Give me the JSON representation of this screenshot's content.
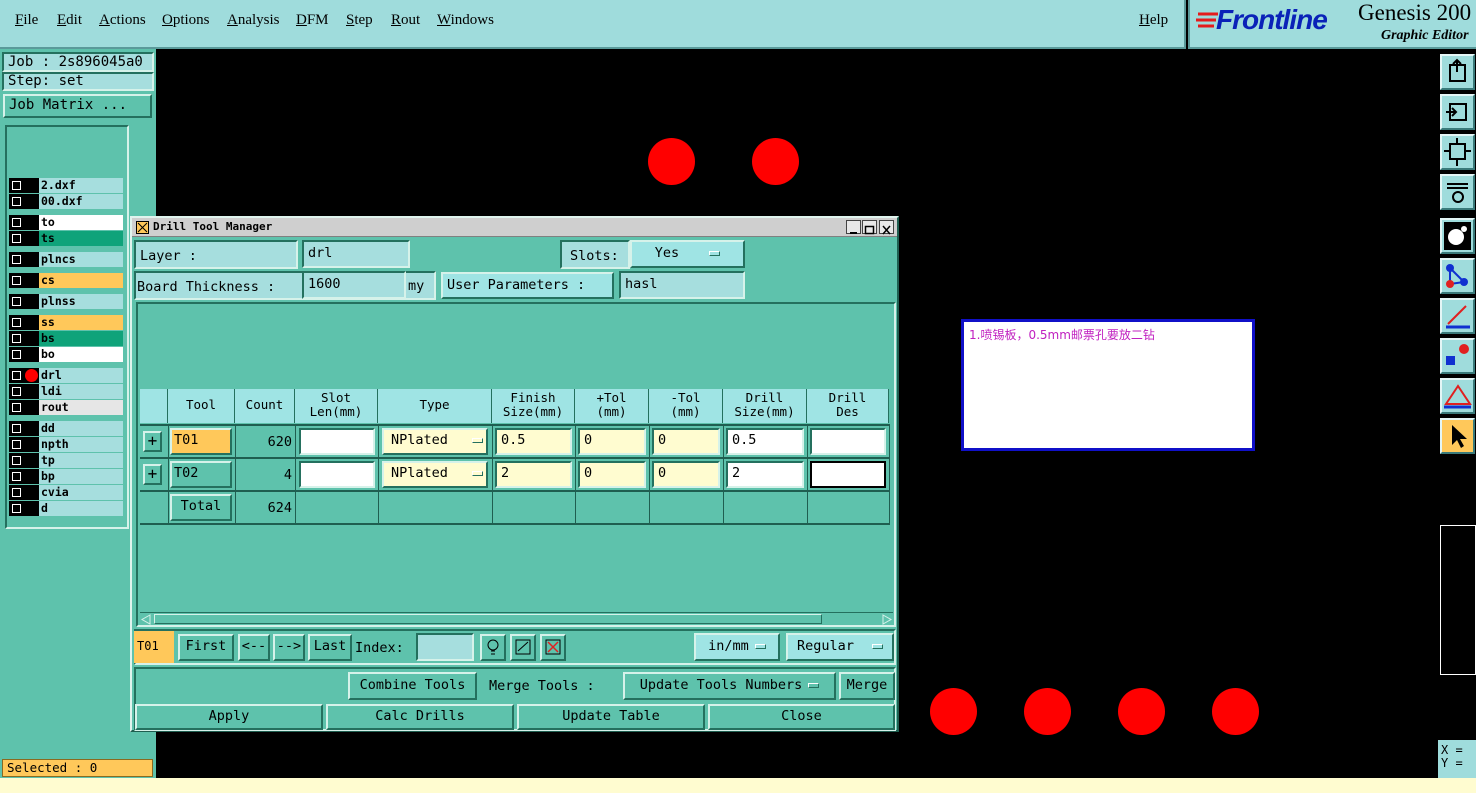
{
  "menu": [
    "File",
    "Edit",
    "Actions",
    "Options",
    "Analysis",
    "DFM",
    "Step",
    "Rout",
    "Windows"
  ],
  "help": "Help",
  "brand": {
    "logo": "Frontline",
    "product": "Genesis 200",
    "subtitle": "Graphic Editor",
    "logo_color": "#0a22b8",
    "product_color": "#000000"
  },
  "left": {
    "job": "Job : 2s896045a0",
    "step": "Step: set",
    "job_matrix": "Job Matrix ...",
    "selected": "Selected : 0",
    "layers": [
      {
        "name": "2.dxf",
        "color": "#a6dede"
      },
      {
        "name": "00.dxf",
        "color": "#a6dede"
      },
      {
        "name": "to",
        "color": "#ffffff"
      },
      {
        "name": "ts",
        "color": "#0fa37a"
      },
      {
        "name": "plncs",
        "color": "#a6dede"
      },
      {
        "name": "cs",
        "color": "#ffc85a"
      },
      {
        "name": "plnss",
        "color": "#a6dede"
      },
      {
        "name": "ss",
        "color": "#ffc85a"
      },
      {
        "name": "bs",
        "color": "#0fa37a"
      },
      {
        "name": "bo",
        "color": "#ffffff"
      },
      {
        "name": "drl",
        "color": "#a6dede"
      },
      {
        "name": "ldi",
        "color": "#a6dede"
      },
      {
        "name": "rout",
        "color": "#e6e6e6"
      },
      {
        "name": "dd",
        "color": "#a6dede"
      },
      {
        "name": "npth",
        "color": "#a6dede"
      },
      {
        "name": "tp",
        "color": "#a6dede"
      },
      {
        "name": "bp",
        "color": "#a6dede"
      },
      {
        "name": "cvia",
        "color": "#a6dede"
      },
      {
        "name": "d",
        "color": "#a6dede"
      }
    ]
  },
  "note": "1.喷锡板，0.5mm邮票孔要放二钻",
  "dialog": {
    "title": "Drill Tool Manager",
    "layer_label": "Layer        :",
    "layer_value": "drl",
    "slots_label": "Slots:",
    "slots_value": "Yes",
    "thickness_label": "Board Thickness :",
    "thickness_value": "1600",
    "thickness_unit": "my",
    "user_params": "User Parameters :",
    "user_params_value": "hasl",
    "headers": [
      {
        "l1": "Tool",
        "l2": ""
      },
      {
        "l1": "Count",
        "l2": ""
      },
      {
        "l1": "Slot",
        "l2": "Len(mm)"
      },
      {
        "l1": "Type",
        "l2": ""
      },
      {
        "l1": "Finish",
        "l2": "Size(mm)"
      },
      {
        "l1": "+Tol",
        "l2": "(mm)"
      },
      {
        "l1": "-Tol",
        "l2": "(mm)"
      },
      {
        "l1": "Drill",
        "l2": "Size(mm)"
      },
      {
        "l1": "Drill",
        "l2": "Des"
      }
    ],
    "rows": [
      {
        "tool": "T01",
        "count": "620",
        "slot": "",
        "type": "NPlated",
        "finish": "0.5",
        "ptol": "0",
        "mtol": "0",
        "drill": "0.5",
        "des": ""
      },
      {
        "tool": "T02",
        "count": "4",
        "slot": "",
        "type": "NPlated",
        "finish": "2",
        "ptol": "0",
        "mtol": "0",
        "drill": "2",
        "des": ""
      }
    ],
    "total_label": "Total",
    "total_count": "624",
    "current_tool": "T01",
    "nav": {
      "first": "First",
      "prev": "<--",
      "next": "-->",
      "last": "Last",
      "index_label": "Index:",
      "index_value": ""
    },
    "units": "in/mm",
    "mode": "Regular",
    "combine": "Combine Tools",
    "merge_label": "Merge Tools :",
    "merge_option": "Update Tools Numbers",
    "merge_btn": "Merge",
    "apply": "Apply",
    "calc": "Calc Drills",
    "update": "Update Table",
    "close": "Close"
  },
  "coords": {
    "x": "X =",
    "y": "Y ="
  },
  "toolbar_icons": [
    "export-icon",
    "import-icon",
    "fit-window-icon",
    "tools-icon",
    "circle-tool-icon",
    "nodes-icon",
    "line-tool-icon",
    "pads-icon",
    "measure-icon",
    "pointer-icon"
  ]
}
